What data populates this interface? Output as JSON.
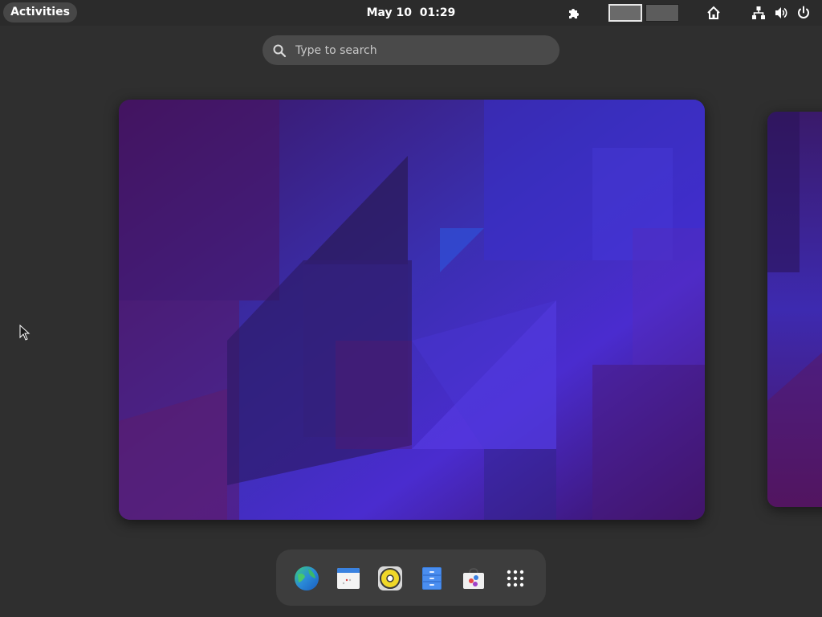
{
  "topbar": {
    "activities_label": "Activities",
    "date": "May 10",
    "time": "01:29"
  },
  "search": {
    "placeholder": "Type to search"
  },
  "workspaces": {
    "count": 2,
    "active_index": 0
  },
  "dock": {
    "items": [
      {
        "icon": "web-browser-icon"
      },
      {
        "icon": "calendar-icon"
      },
      {
        "icon": "rhythmbox-music-icon"
      },
      {
        "icon": "files-cabinet-icon"
      },
      {
        "icon": "software-store-icon"
      },
      {
        "icon": "show-apps-grid-icon"
      }
    ]
  },
  "colors": {
    "panel_bg": "#2b2b2b",
    "overview_bg": "#2f2f2f",
    "wallpaper_purple": "#4a1a8a",
    "wallpaper_blue": "#3a2fd0"
  }
}
